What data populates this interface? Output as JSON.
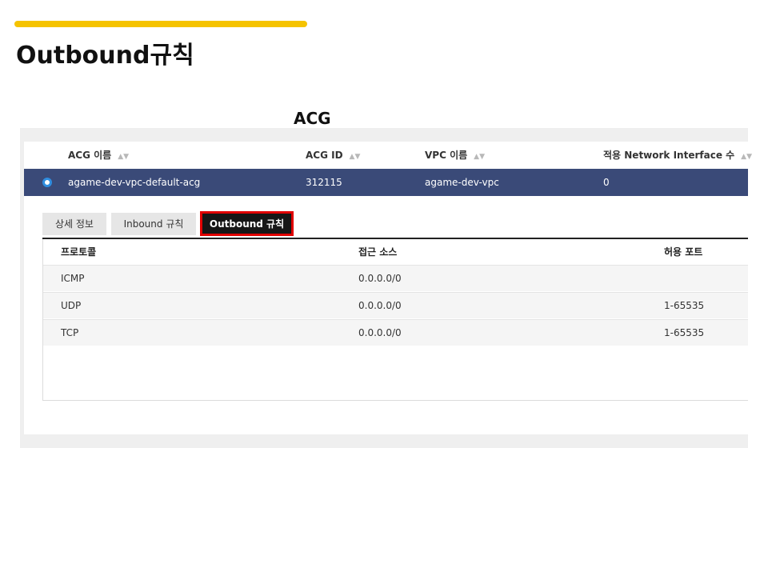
{
  "slide": {
    "title": "Outbound규칙",
    "caption": "ACG",
    "accent_color": "#f5c300"
  },
  "acg_table": {
    "columns": [
      {
        "label": "ACG 이름"
      },
      {
        "label": "ACG ID"
      },
      {
        "label": "VPC 이름"
      },
      {
        "label": "적용 Network Interface 수"
      }
    ],
    "sort_icon": "sort-icon",
    "selected_row": {
      "name": "agame-dev-vpc-default-acg",
      "id": "312115",
      "vpc": "agame-dev-vpc",
      "nic_count": "0"
    },
    "row_color": "#3a4a78"
  },
  "tabs": [
    {
      "label": "상세 정보",
      "active": false
    },
    {
      "label": "Inbound 규칙",
      "active": false
    },
    {
      "label": "Outbound 규칙",
      "active": true
    }
  ],
  "highlight_color": "#e00000",
  "rules_table": {
    "columns": [
      "프로토콜",
      "접근 소스",
      "허용 포트"
    ],
    "rows": [
      {
        "protocol": "ICMP",
        "source": "0.0.0.0/0",
        "port": ""
      },
      {
        "protocol": "UDP",
        "source": "0.0.0.0/0",
        "port": "1-65535"
      },
      {
        "protocol": "TCP",
        "source": "0.0.0.0/0",
        "port": "1-65535"
      }
    ]
  }
}
